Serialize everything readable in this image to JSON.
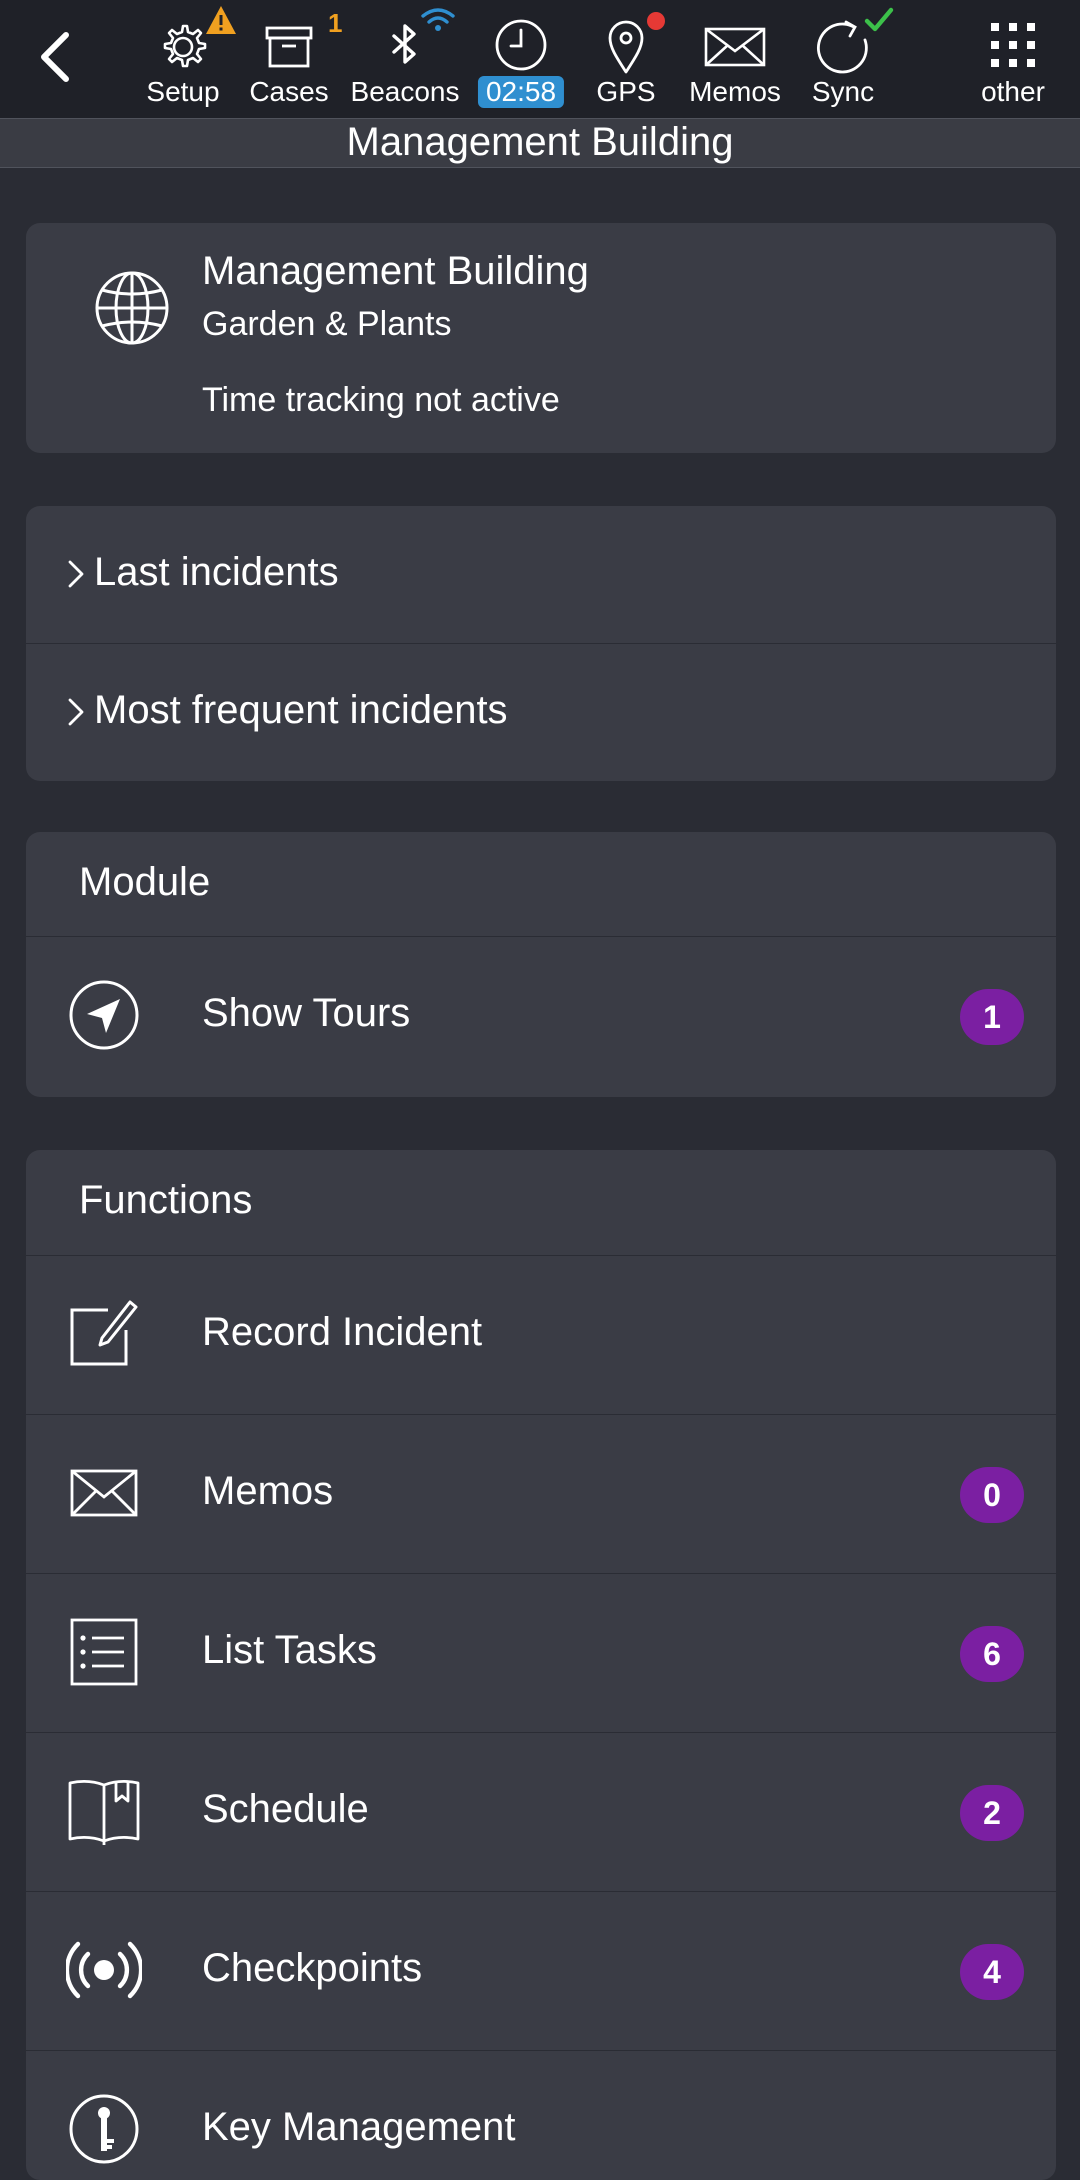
{
  "toolbar": {
    "back_label": "",
    "items": [
      {
        "label": "Setup",
        "icon": "gear-icon"
      },
      {
        "label": "Cases",
        "icon": "box-icon",
        "count": "1"
      },
      {
        "label": "Beacons",
        "icon": "bluetooth-icon"
      },
      {
        "label": "02:58",
        "icon": "clock-icon"
      },
      {
        "label": "GPS",
        "icon": "map-pin-icon"
      },
      {
        "label": "Memos",
        "icon": "envelope-icon"
      },
      {
        "label": "Sync",
        "icon": "sync-icon"
      },
      {
        "label": "other",
        "icon": "grid-icon"
      }
    ],
    "colors": {
      "warning": "#f0a020",
      "wifi": "#2f8fd0",
      "gps_dot": "#e53935",
      "sync_ok": "#3cc04a"
    }
  },
  "title": "Management Building",
  "site": {
    "name": "Management Building",
    "subtitle": "Garden & Plants",
    "status": "Time tracking not active"
  },
  "incidents": {
    "last": "Last incidents",
    "frequent": "Most frequent incidents"
  },
  "module": {
    "header": "Module",
    "items": [
      {
        "label": "Show Tours",
        "badge": "1"
      }
    ]
  },
  "functions": {
    "header": "Functions",
    "items": [
      {
        "label": "Record Incident",
        "badge": ""
      },
      {
        "label": "Memos",
        "badge": "0"
      },
      {
        "label": "List Tasks",
        "badge": "6"
      },
      {
        "label": "Schedule",
        "badge": "2"
      },
      {
        "label": "Checkpoints",
        "badge": "4"
      },
      {
        "label": "Key Management",
        "badge": ""
      }
    ]
  },
  "badge_color": "#7b1fa2"
}
